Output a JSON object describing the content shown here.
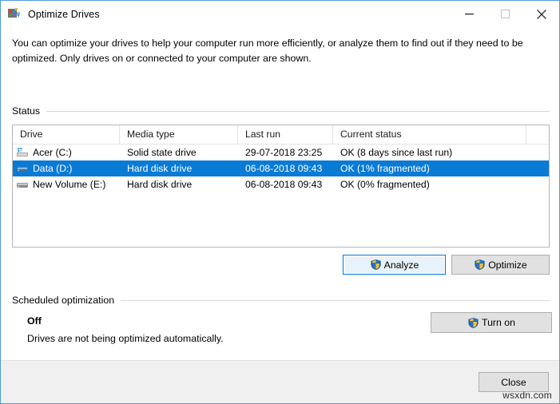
{
  "window": {
    "title": "Optimize Drives",
    "icon": "optimize-drives-icon",
    "controls": {
      "minimize": "minimize-icon",
      "maximize": "maximize-icon",
      "close": "close-icon"
    },
    "border_color": "#4b9ed6"
  },
  "description": "You can optimize your drives to help your computer run more efficiently, or analyze them to find out if they need to be optimized. Only drives on or connected to your computer are shown.",
  "status_group": {
    "label": "Status",
    "columns": [
      "Drive",
      "Media type",
      "Last run",
      "Current status"
    ],
    "rows": [
      {
        "icon": "ssd-drive-icon",
        "drive": "Acer (C:)",
        "media_type": "Solid state drive",
        "last_run": "29-07-2018 23:25",
        "current_status": "OK (8 days since last run)",
        "selected": false
      },
      {
        "icon": "hard-disk-drive-icon",
        "drive": "Data (D:)",
        "media_type": "Hard disk drive",
        "last_run": "06-08-2018 09:43",
        "current_status": "OK (1% fragmented)",
        "selected": true
      },
      {
        "icon": "hard-disk-drive-icon",
        "drive": "New Volume (E:)",
        "media_type": "Hard disk drive",
        "last_run": "06-08-2018 09:43",
        "current_status": "OK (0% fragmented)",
        "selected": false
      }
    ],
    "selection_color": "#0a7bd4"
  },
  "actions": {
    "analyze": "Analyze",
    "optimize": "Optimize",
    "shield_icon": "uac-shield-icon"
  },
  "scheduled_group": {
    "label": "Scheduled optimization",
    "state": "Off",
    "note": "Drives are not being optimized automatically.",
    "turn_on": "Turn on"
  },
  "footer": {
    "close": "Close"
  },
  "watermark": "wsxdn.com"
}
